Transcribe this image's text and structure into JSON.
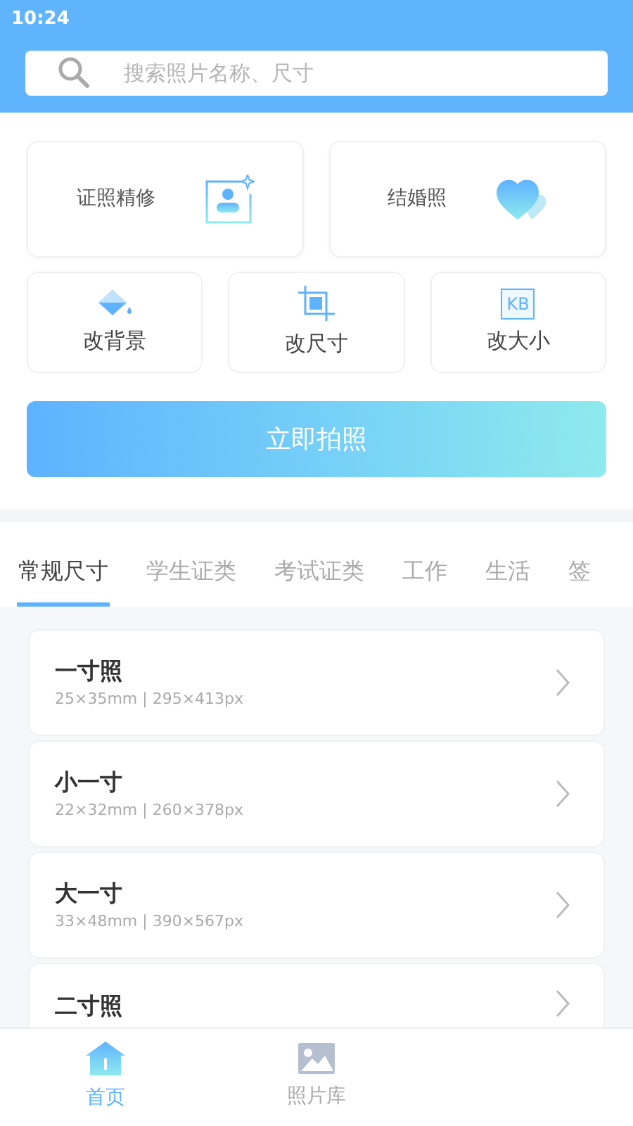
{
  "status_bar": {
    "time": "10:24"
  },
  "search": {
    "placeholder": "搜索照片名称、尺寸"
  },
  "feature_cards": [
    {
      "label": "证照精修",
      "kind": "portrait"
    },
    {
      "label": "结婚照",
      "kind": "heart"
    }
  ],
  "tools": [
    {
      "label": "改背景",
      "kind": "bucket"
    },
    {
      "label": "改尺寸",
      "kind": "crop"
    },
    {
      "label": "改大小",
      "kind": "kb",
      "badge": "KB"
    }
  ],
  "capture_button": "立即拍照",
  "tabs": [
    {
      "label": "常规尺寸",
      "selected": true
    },
    {
      "label": "学生证类",
      "selected": false
    },
    {
      "label": "考试证类",
      "selected": false
    },
    {
      "label": "工作",
      "selected": false
    },
    {
      "label": "生活",
      "selected": false
    },
    {
      "label": "签",
      "selected": false
    }
  ],
  "sizes": [
    {
      "title": "一寸照",
      "detail": "25×35mm | 295×413px"
    },
    {
      "title": "小一寸",
      "detail": "22×32mm | 260×378px"
    },
    {
      "title": "大一寸",
      "detail": "33×48mm | 390×567px"
    },
    {
      "title": "二寸照"
    }
  ],
  "bottom_nav": [
    {
      "label": "首页",
      "kind": "home",
      "selected": true
    },
    {
      "label": "照片库",
      "kind": "gallery",
      "selected": false
    }
  ]
}
